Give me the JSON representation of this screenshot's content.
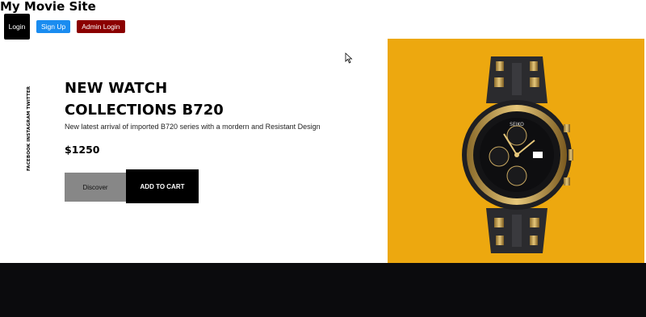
{
  "site": {
    "title": "My Movie Site"
  },
  "auth": {
    "login": "Login",
    "signup": "Sign Up",
    "admin_login": "Admin Login"
  },
  "social": {
    "facebook": "FACEBOOK",
    "instagram": "INSTAGRAM",
    "twitter": "TWITTER"
  },
  "hero": {
    "title": "NEW WATCH",
    "subtitle": "COLLECTIONS B720",
    "description": "New latest arrival of imported B720 series with a mordern and Resistant Design",
    "price": "$1250",
    "discover_label": "Discover",
    "cart_label": "ADD TO CART"
  },
  "product": {
    "image_icon": "wristwatch-icon",
    "dial_brand": "SEIKO",
    "panel_color": "#eda80f"
  },
  "colors": {
    "signup": "#1a8cf0",
    "admin": "#8b0000",
    "footer": "#0b0b0d"
  }
}
